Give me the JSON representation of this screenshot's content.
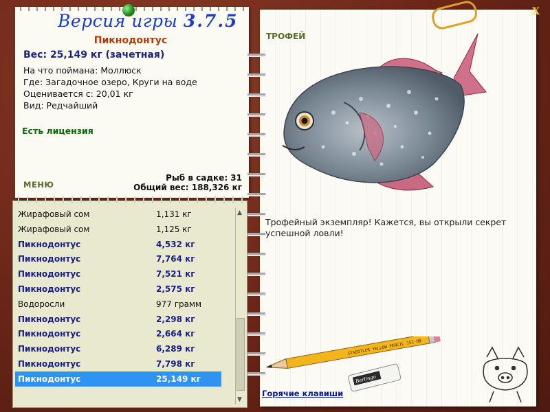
{
  "app": {
    "close_label": "X"
  },
  "version": {
    "prefix": "Версия игры",
    "number": "3.7.5"
  },
  "fish": {
    "name": "Пикнодонтус",
    "weight_line": "Вес: 25,149 кг (зачетная)",
    "caught_on": "На что поймана: Моллюск",
    "location": "Где: Загадочное озеро, Круги на воде",
    "valued_from": "Оценивается с: 20,01 кг",
    "kind": "Вид: Редчайший",
    "license": "Есть лицензия"
  },
  "menu": {
    "label": "МЕНЮ"
  },
  "stats": {
    "fish_in_keepnet": "Рыб в садке: 31",
    "total_weight": "Общий вес: 188,326 кг"
  },
  "catch_list": [
    {
      "name": "Жирафовый сом",
      "weight": "1,131 кг",
      "rare": false,
      "selected": false
    },
    {
      "name": "Жирафовый сом",
      "weight": "1,125 кг",
      "rare": false,
      "selected": false
    },
    {
      "name": "Пикнодонтус",
      "weight": "4,532 кг",
      "rare": true,
      "selected": false
    },
    {
      "name": "Пикнодонтус",
      "weight": "7,764 кг",
      "rare": true,
      "selected": false
    },
    {
      "name": "Пикнодонтус",
      "weight": "7,521 кг",
      "rare": true,
      "selected": false
    },
    {
      "name": "Пикнодонтус",
      "weight": "2,575 кг",
      "rare": true,
      "selected": false
    },
    {
      "name": "Водоросли",
      "weight": "977 грамм",
      "rare": false,
      "selected": false
    },
    {
      "name": "Пикнодонтус",
      "weight": "2,298 кг",
      "rare": true,
      "selected": false
    },
    {
      "name": "Пикнодонтус",
      "weight": "2,664 кг",
      "rare": true,
      "selected": false
    },
    {
      "name": "Пикнодонтус",
      "weight": "6,289 кг",
      "rare": true,
      "selected": false
    },
    {
      "name": "Пикнодонтус",
      "weight": "7,798 кг",
      "rare": true,
      "selected": false
    },
    {
      "name": "Пикнодонтус",
      "weight": "25,149 кг",
      "rare": true,
      "selected": true
    }
  ],
  "trophy": {
    "label": "ТРОФЕЙ",
    "caption": "Трофейный экземпляр! Кажется, вы открыли секрет успешной ловли!"
  },
  "pencil": {
    "text": "STAEDTLER YELLOW PENCIL 152 HB"
  },
  "eraser": {
    "text": "Berlingo"
  },
  "hotkeys": {
    "label": "Горячие клавиши"
  },
  "icons": [
    "pin-icon",
    "paperclip-icon",
    "pencil-icon",
    "eraser-icon",
    "pig-logo-icon",
    "close-icon",
    "scroll-up-icon",
    "scroll-down-icon"
  ],
  "colors": {
    "frame": "#6e2a1c",
    "version": "#1a3cc8",
    "fish_name": "#b23c06",
    "rare_row": "#1a1f86",
    "selected_row": "#2f93f2",
    "license": "#0c6b0c"
  }
}
